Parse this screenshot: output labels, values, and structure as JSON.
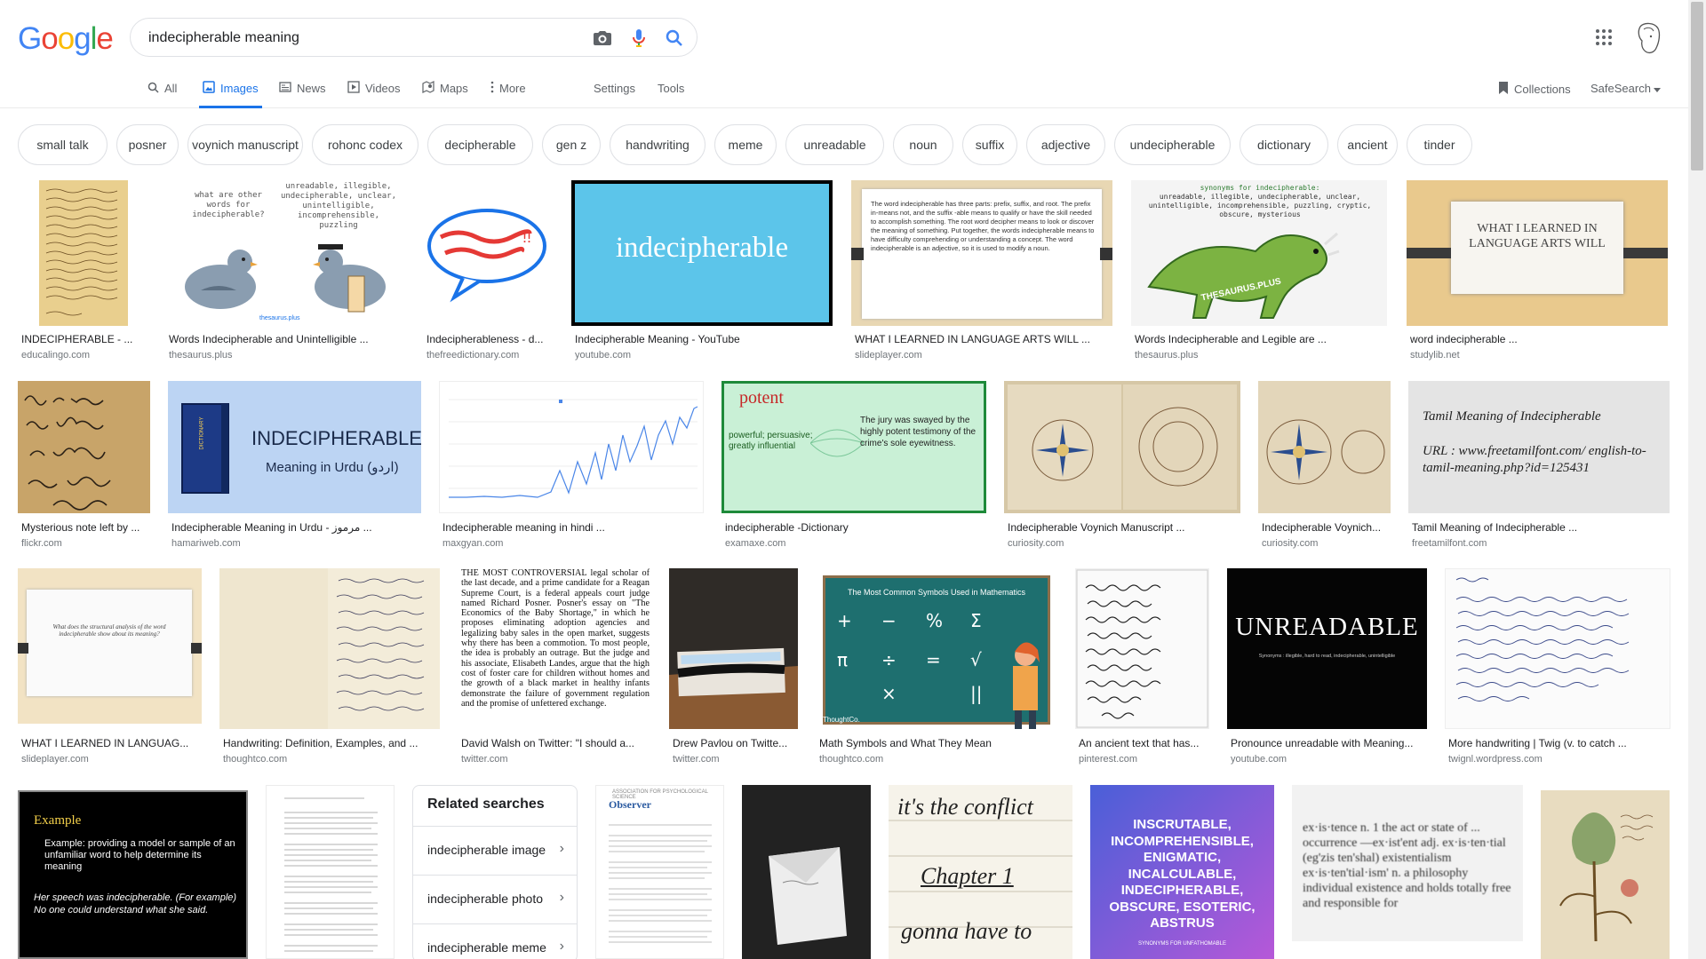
{
  "header": {
    "logo_letters": [
      "G",
      "o",
      "o",
      "g",
      "l",
      "e"
    ],
    "logo_colors": [
      "#4285F4",
      "#EA4335",
      "#FBBC05",
      "#4285F4",
      "#34A853",
      "#EA4335"
    ],
    "query": "indecipherable meaning"
  },
  "tabs": {
    "all": "All",
    "images": "Images",
    "news": "News",
    "videos": "Videos",
    "maps": "Maps",
    "more": "More",
    "settings": "Settings",
    "tools": "Tools",
    "collections": "Collections",
    "safesearch": "SafeSearch"
  },
  "chips": [
    "small talk",
    "posner",
    "voynich manuscript",
    "rohonc codex",
    "decipherable",
    "gen z",
    "handwriting",
    "meme",
    "unreadable",
    "noun",
    "suffix",
    "adjective",
    "undecipherable",
    "dictionary",
    "ancient",
    "tinder"
  ],
  "results": {
    "row1": [
      {
        "caption": "INDECIPHERABLE - ...",
        "source": "educalingo.com"
      },
      {
        "caption": "Words Indecipherable and Unintelligible ...",
        "source": "thesaurus.plus"
      },
      {
        "caption": "Indecipherableness - d...",
        "source": "thefreedictionary.com"
      },
      {
        "caption": "Indecipherable Meaning - YouTube",
        "source": "youtube.com"
      },
      {
        "caption": "WHAT I LEARNED IN LANGUAGE ARTS WILL ...",
        "source": "slideplayer.com"
      },
      {
        "caption": "Words Indecipherable and Legible are ...",
        "source": "thesaurus.plus"
      },
      {
        "caption": "word indecipherable ...",
        "source": "studylib.net"
      }
    ],
    "row2": [
      {
        "caption": "Mysterious note left by ...",
        "source": "flickr.com"
      },
      {
        "caption": "Indecipherable Meaning in Urdu - مرموز ...",
        "source": "hamariweb.com"
      },
      {
        "caption": "Indecipherable meaning in hindi ...",
        "source": "maxgyan.com"
      },
      {
        "caption": "indecipherable -Dictionary",
        "source": "examaxe.com"
      },
      {
        "caption": "Indecipherable Voynich Manuscript ...",
        "source": "curiosity.com"
      },
      {
        "caption": "Indecipherable Voynich...",
        "source": "curiosity.com"
      },
      {
        "caption": "Tamil Meaning of Indecipherable ...",
        "source": "freetamilfont.com"
      }
    ],
    "row3": [
      {
        "caption": "WHAT I LEARNED IN LANGUAG...",
        "source": "slideplayer.com"
      },
      {
        "caption": "Handwriting: Definition, Examples, and ...",
        "source": "thoughtco.com"
      },
      {
        "caption": "David Walsh on Twitter: \"I should a...",
        "source": "twitter.com"
      },
      {
        "caption": "Drew Pavlou on Twitte...",
        "source": "twitter.com"
      },
      {
        "caption": "Math Symbols and What They Mean",
        "source": "thoughtco.com"
      },
      {
        "caption": "An ancient text that has...",
        "source": "pinterest.com"
      },
      {
        "caption": "Pronounce unreadable with Meaning...",
        "source": "youtube.com"
      },
      {
        "caption": "More handwriting | Twig (v. to catch ...",
        "source": "twignl.wordpress.com"
      }
    ]
  },
  "thumb_text": {
    "pigeon_left": "what are other words for indecipherable?",
    "pigeon_right": "unreadable, illegible, undecipherable, unclear, unintelligible, incomprehensible, puzzling",
    "pigeon_brand": "thesaurus.plus",
    "youtube_word": "indecipherable",
    "slide_text": "The word indecipherable has three parts: prefix, suffix, and root. The prefix in-means not, and the suffix -able means to qualify or have the skill needed to accomplish something. The root word decipher means to look or discover the meaning of something. Put together, the words indecipherable means to have difficulty comprehending or understanding a concept. The word indecipherable is an adjective, so it is used to modify a noun.",
    "dino_title": "synonyms for indecipherable:",
    "dino_list": "unreadable, illegible, undecipherable, unclear, unintelligible, incomprehensible, puzzling, cryptic, obscure, mysterious",
    "dino_brand": "THESAURUS.PLUS",
    "studylib_text": "WHAT I LEARNED IN LANGUAGE ARTS WILL",
    "urdu_title": "INDECIPHERABLE",
    "urdu_sub": "Meaning in Urdu (اردو)",
    "dictionary_label": "DICTIONARY",
    "potent_word": "potent",
    "potent_meaning": "powerful; persuasive; greatly influential",
    "potent_example": "The jury was swayed by the highly potent testimony of the crime's sole eyewitness.",
    "tamil_title": "Tamil Meaning of Indecipherable",
    "tamil_url": "URL : www.freetamilfont.com/ english-to-tamil-meaning.php?id=125431",
    "slide2_text": "What does the structural analysis of the word indecipherable show about its meaning?",
    "posner_text": "THE MOST CONTROVERSIAL legal scholar of the last decade, and a prime candidate for a Reagan Supreme Court, is a federal appeals court judge named Richard Posner. Posner's essay on \"The Economics of the Baby Shortage,\" in which he proposes eliminating adoption agencies and legalizing baby sales in the open market, suggests why there has been a commotion. To most people, the idea is probably an outrage. But the judge and his associate, Elisabeth Landes, argue that the high cost of foster care for children without homes and the growth of a black market in healthy infants demonstrate the failure of government regulation and the promise of unfettered exchange.",
    "math_title": "The Most Common Symbols Used in Mathematics",
    "math_brand": "ThoughtCo.",
    "unreadable_word": "UNREADABLE",
    "unreadable_syn": "Synonyms : illegible, hard to read, indecipherable, unintelligible",
    "example_title": "Example",
    "example_body": "Example: providing a model or sample of an unfamiliar word to help determine its meaning",
    "example_sentence": "Her speech was indecipherable. (For example) No one could understand what she said.",
    "observer_brand": "Observer",
    "observer_org": "ASSOCIATION FOR PSYCHOLOGICAL SCIENCE",
    "conflict_line1": "it's the conflict",
    "conflict_line2": "Chapter 1",
    "conflict_line3": "gonna have to",
    "inscrutable_text": "INSCRUTABLE, INCOMPREHENSIBLE, ENIGMATIC, INCALCULABLE, INDECIPHERABLE, OBSCURE, ESOTERIC, ABSTRUS",
    "inscrutable_sub": "SYNONYMS FOR UNFATHOMABLE",
    "existence_text": "ex·is·tence n. 1 the act or state of ... occurrence —ex·ist'ent adj. ex·is·ten·tial (eg'zis ten'shal) existentialism ex·is·ten'tial·ism' n. a philosophy individual existence and holds totally free and responsible for"
  },
  "related": {
    "title": "Related searches",
    "items": [
      "indecipherable image",
      "indecipherable photo",
      "indecipherable meme"
    ]
  }
}
